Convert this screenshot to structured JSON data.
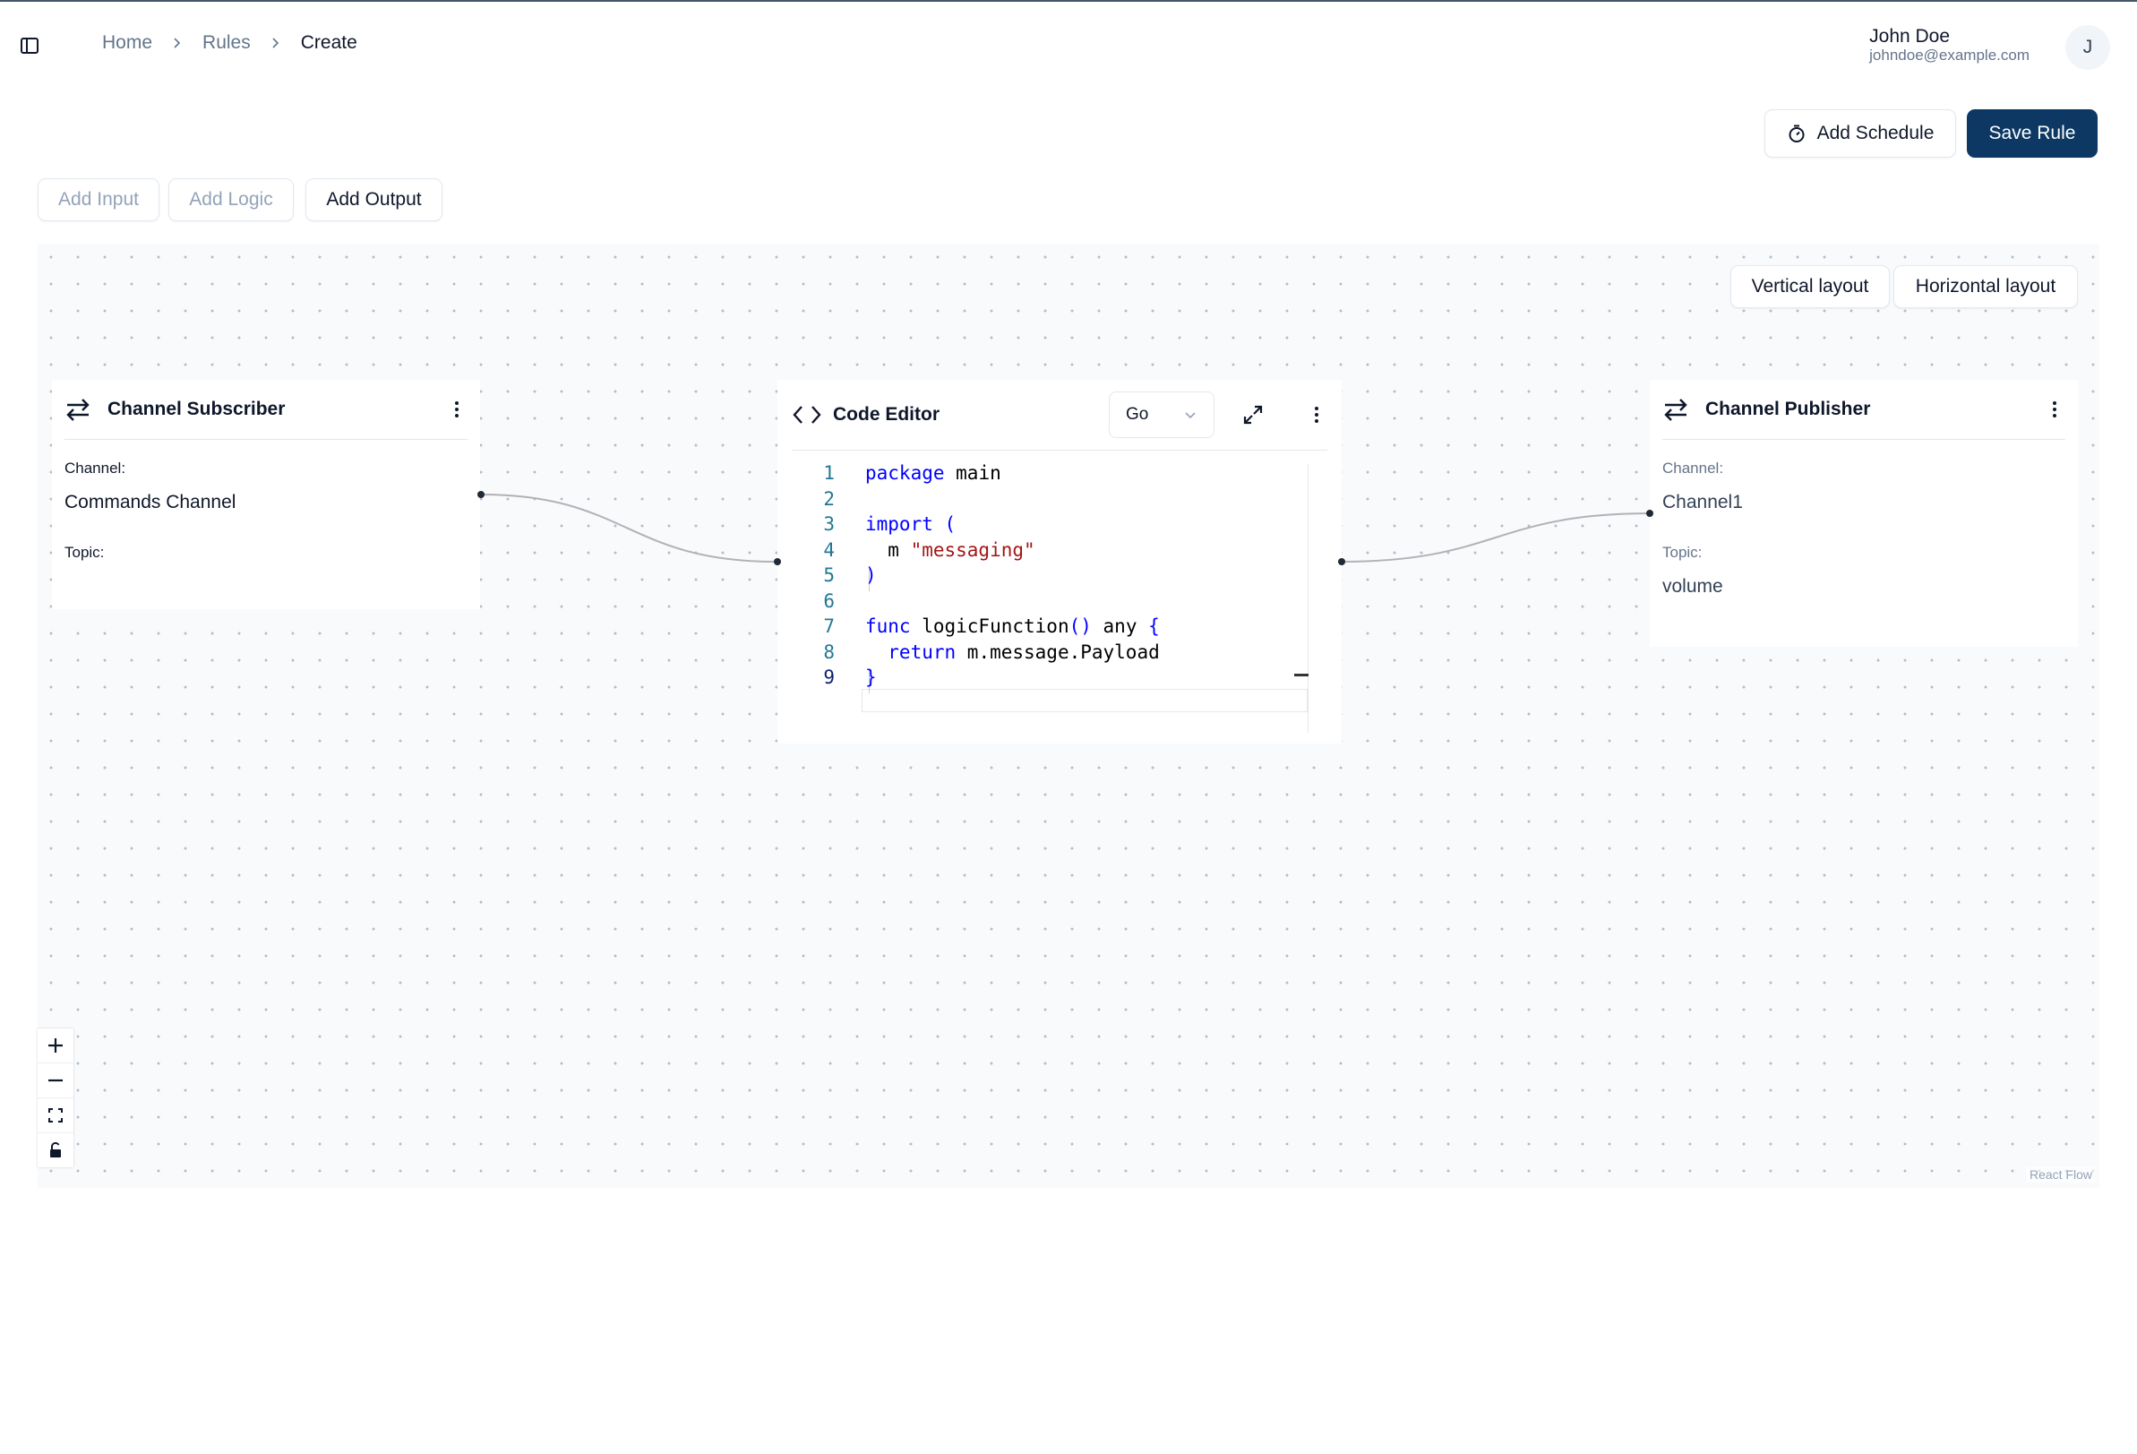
{
  "header": {
    "breadcrumb": [
      "Home",
      "Rules",
      "Create"
    ],
    "user": {
      "name": "John Doe",
      "email": "johndoe@example.com",
      "initial": "J"
    }
  },
  "actions": {
    "add_schedule": "Add Schedule",
    "save_rule": "Save Rule"
  },
  "toolbar": {
    "add_input": "Add Input",
    "add_logic": "Add Logic",
    "add_output": "Add Output"
  },
  "layout": {
    "vertical": "Vertical layout",
    "horizontal": "Horizontal layout"
  },
  "nodes": {
    "subscriber": {
      "title": "Channel Subscriber",
      "channel_label": "Channel:",
      "channel_value": "Commands Channel",
      "topic_label": "Topic:",
      "topic_value": ""
    },
    "code_editor": {
      "title": "Code Editor",
      "language": "Go",
      "line_numbers": [
        "1",
        "2",
        "3",
        "4",
        "5",
        "6",
        "7",
        "8",
        "9"
      ],
      "code": {
        "l1_kw": "package",
        "l1_rest": " main",
        "l3_kw": "import (",
        "l4_a": "  m ",
        "l4_str": "\"messaging\"",
        "l5": ")",
        "l7_kw": "func",
        "l7_mid": " logicFunction",
        "l7_paren": "()",
        "l7_any": " any ",
        "l7_brace": "{",
        "l8_kw": "  return",
        "l8_rest": " m.message.Payload",
        "l9": "}"
      }
    },
    "publisher": {
      "title": "Channel Publisher",
      "channel_label": "Channel:",
      "channel_value": "Channel1",
      "topic_label": "Topic:",
      "topic_value": "volume"
    }
  },
  "canvas": {
    "attribution": "React Flow"
  },
  "colors": {
    "primary": "#0c3863",
    "canvas_bg": "#f8fafc",
    "keyword": "#0000ff",
    "string": "#a31515"
  }
}
